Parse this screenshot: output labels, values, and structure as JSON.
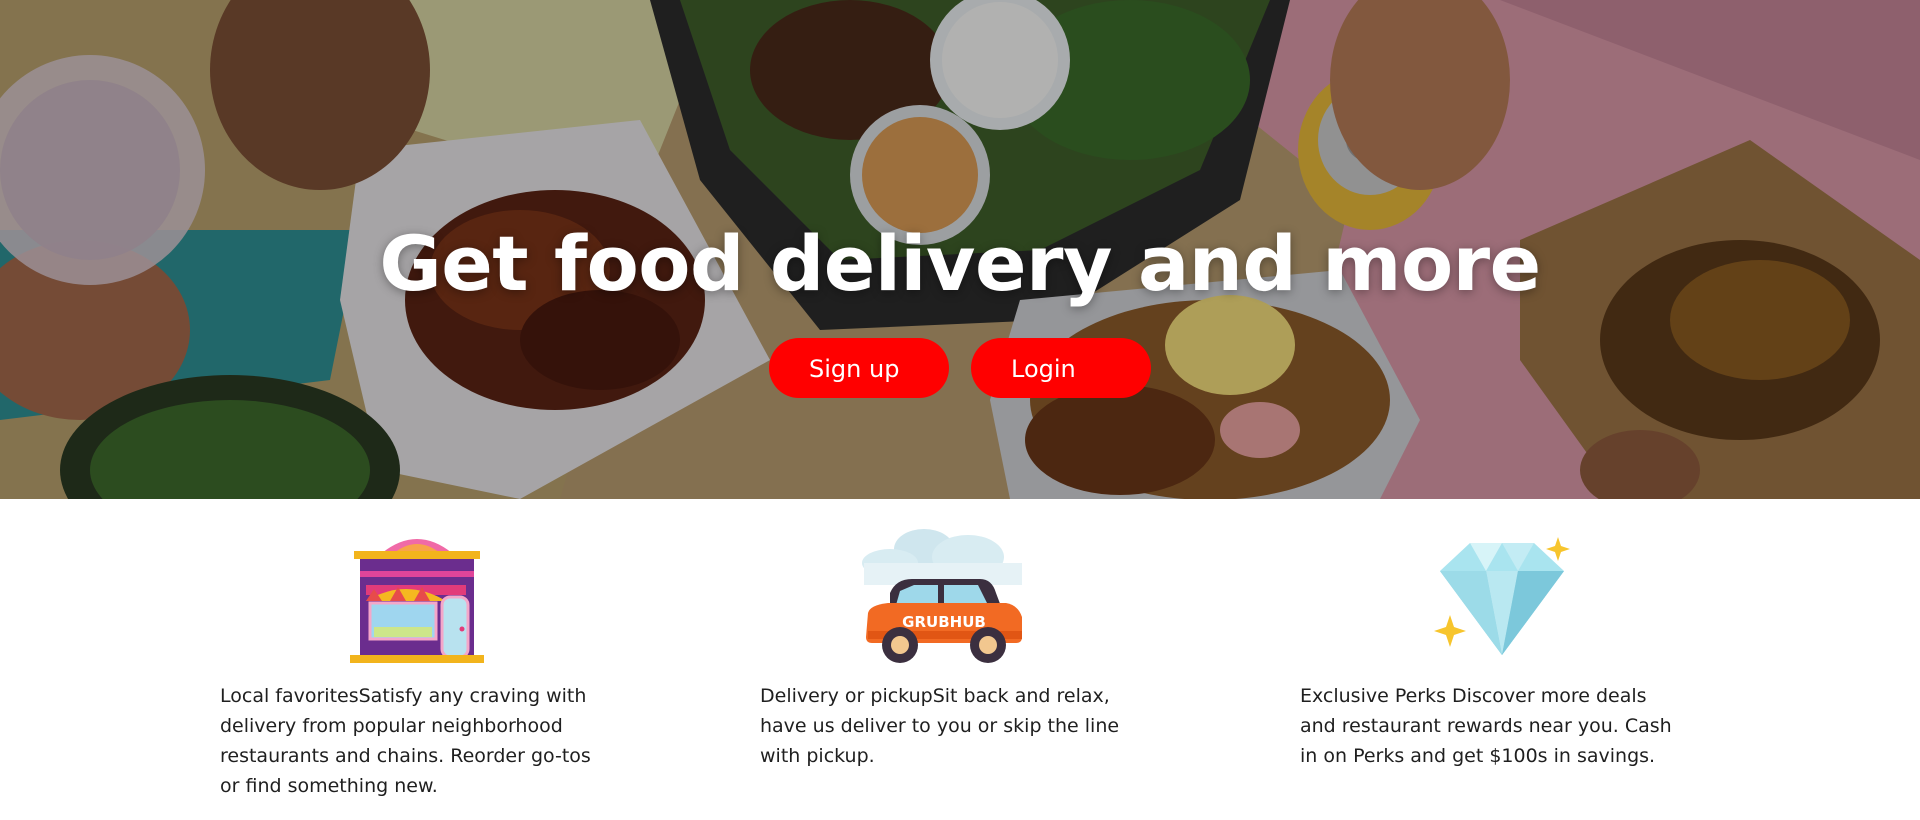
{
  "hero": {
    "title": "Get food delivery and more",
    "signup_label": "Sign up",
    "login_label": "Login",
    "button_color": "#ff0000",
    "background_description_icon": "food-table-photo"
  },
  "features": [
    {
      "icon": "storefront-icon",
      "text": "Local favoritesSatisfy any craving with delivery from popular neighborhood restaurants and chains. Reorder go-tos or find something new."
    },
    {
      "icon": "delivery-car-icon",
      "car_label": "GRUBHUB",
      "text": "Delivery or pickupSit back and relax, have us deliver to you or skip the line with pickup."
    },
    {
      "icon": "diamond-icon",
      "text": "Exclusive Perks Discover more deals and restaurant rewards near you. Cash in on Perks and get $100s in savings."
    }
  ]
}
